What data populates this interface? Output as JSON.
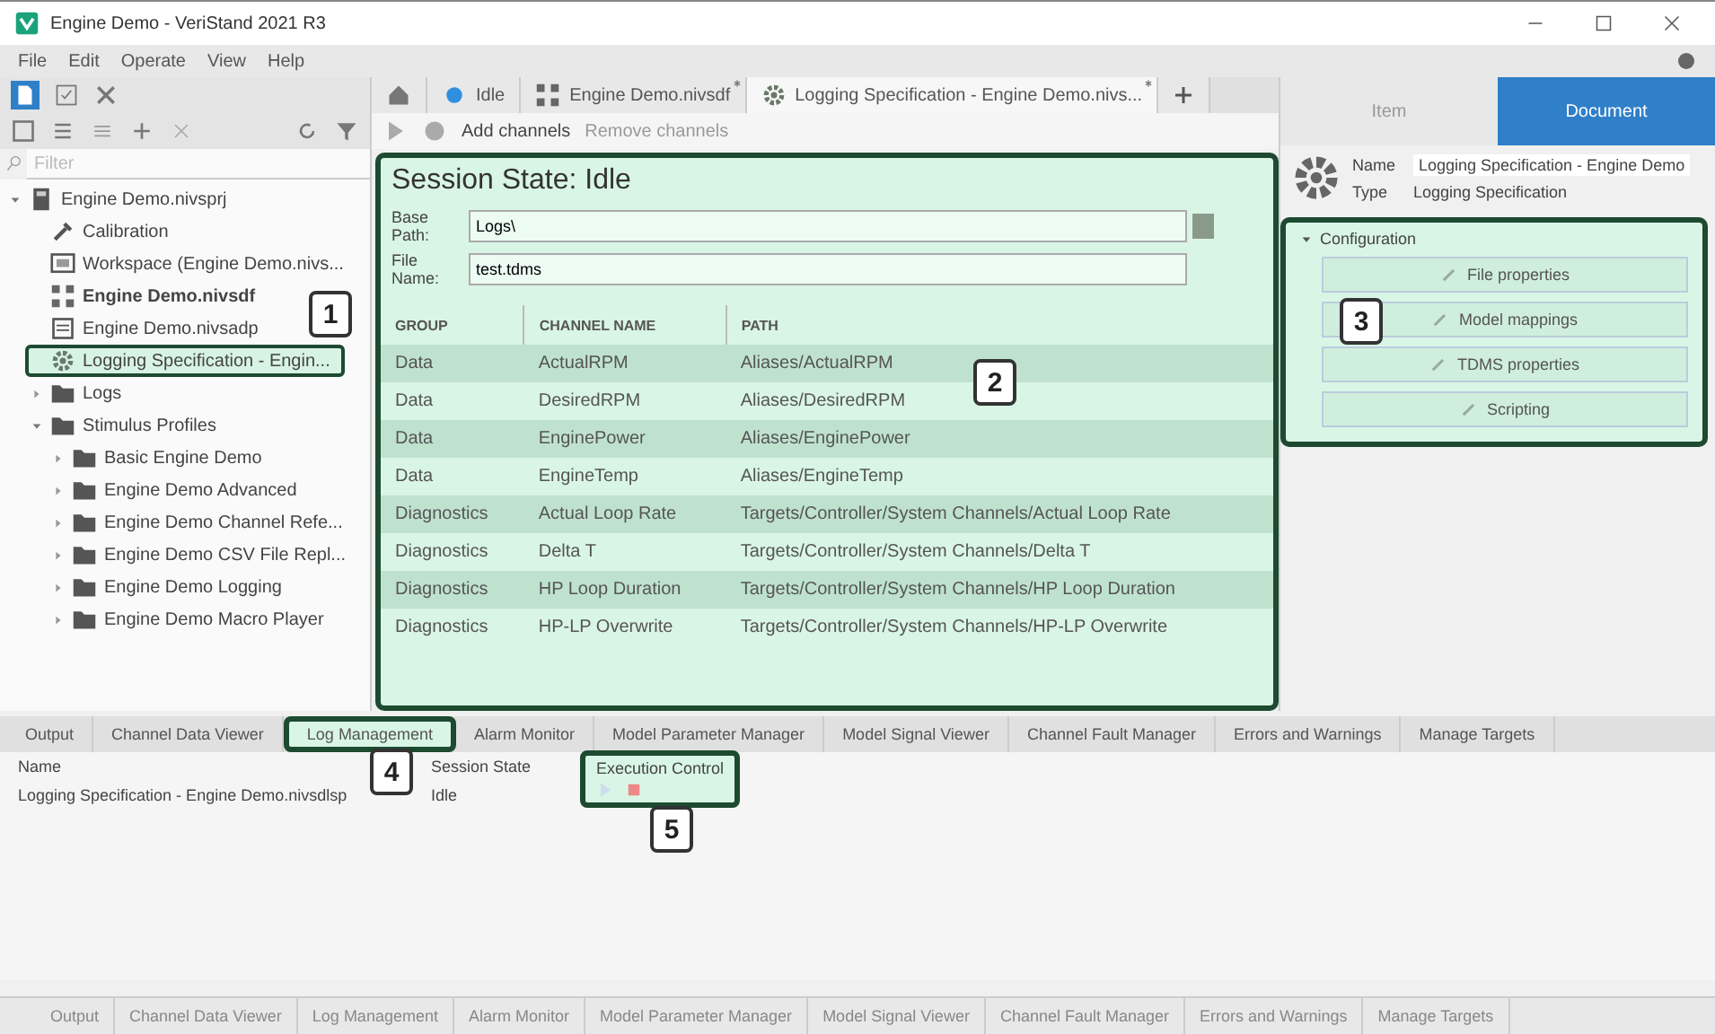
{
  "window": {
    "title": "Engine Demo - VeriStand 2021 R3"
  },
  "menu": [
    "File",
    "Edit",
    "Operate",
    "View",
    "Help"
  ],
  "left_panel": {
    "search": {
      "placeholder": "Filter"
    },
    "tree": [
      {
        "label": "Engine Demo.nivsprj",
        "kind": "project",
        "expanded": true,
        "selected": false,
        "active": false,
        "children": [
          {
            "label": "Calibration",
            "kind": "calibration",
            "selected": false,
            "active": false
          },
          {
            "label": "Workspace (Engine Demo.nivs...",
            "kind": "workspace",
            "selected": false,
            "active": false
          },
          {
            "label": "Engine Demo.nivsdf",
            "kind": "sysdef",
            "selected": false,
            "active": true
          },
          {
            "label": "Engine Demo.nivsadp",
            "kind": "file",
            "selected": false,
            "active": false
          },
          {
            "label": "Logging Specification - Engin...",
            "kind": "gear",
            "selected": true,
            "active": false
          },
          {
            "label": "Logs",
            "kind": "folder",
            "expanded": false,
            "selected": false,
            "active": false
          },
          {
            "label": "Stimulus Profiles",
            "kind": "folder",
            "expanded": true,
            "selected": false,
            "active": false,
            "children": [
              {
                "label": "Basic Engine Demo",
                "kind": "folder",
                "expanded": false,
                "selected": false,
                "active": false
              },
              {
                "label": "Engine Demo Advanced",
                "kind": "folder",
                "expanded": false,
                "selected": false,
                "active": false
              },
              {
                "label": "Engine Demo Channel Refe...",
                "kind": "folder",
                "expanded": false,
                "selected": false,
                "active": false
              },
              {
                "label": "Engine Demo CSV File Repl...",
                "kind": "folder",
                "expanded": false,
                "selected": false,
                "active": false
              },
              {
                "label": "Engine Demo Logging",
                "kind": "folder",
                "expanded": false,
                "selected": false,
                "active": false
              },
              {
                "label": "Engine Demo Macro Player",
                "kind": "folder",
                "expanded": false,
                "selected": false,
                "active": false
              }
            ]
          }
        ]
      }
    ]
  },
  "document_tabs": [
    {
      "label": "Idle",
      "kind": "status",
      "selected": false,
      "modified": false
    },
    {
      "label": "Engine Demo.nivsdf",
      "kind": "sysdef",
      "selected": false,
      "modified": true
    },
    {
      "label": "Logging Specification - Engine Demo.nivs...",
      "kind": "gear",
      "selected": true,
      "modified": true
    }
  ],
  "center_toolbar": {
    "add_channels": {
      "label": "Add channels",
      "disabled": false
    },
    "remove_channels": {
      "label": "Remove channels",
      "disabled": true
    }
  },
  "session": {
    "title": "Session State: Idle",
    "base_path": {
      "label": "Base Path:",
      "value": "Logs\\"
    },
    "file_name": {
      "label": "File Name:",
      "value": "test.tdms"
    },
    "table": {
      "columns": [
        "GROUP",
        "CHANNEL NAME",
        "PATH"
      ],
      "rows": [
        [
          "Data",
          "ActualRPM",
          "Aliases/ActualRPM"
        ],
        [
          "Data",
          "DesiredRPM",
          "Aliases/DesiredRPM"
        ],
        [
          "Data",
          "EnginePower",
          "Aliases/EnginePower"
        ],
        [
          "Data",
          "EngineTemp",
          "Aliases/EngineTemp"
        ],
        [
          "Diagnostics",
          "Actual Loop Rate",
          "Targets/Controller/System Channels/Actual Loop Rate"
        ],
        [
          "Diagnostics",
          "Delta T",
          "Targets/Controller/System Channels/Delta T"
        ],
        [
          "Diagnostics",
          "HP Loop Duration",
          "Targets/Controller/System Channels/HP Loop Duration"
        ],
        [
          "Diagnostics",
          "HP-LP Overwrite",
          "Targets/Controller/System Channels/HP-LP Overwrite"
        ]
      ]
    }
  },
  "properties": {
    "tabs": [
      {
        "label": "Item",
        "selected": false
      },
      {
        "label": "Document",
        "selected": true
      }
    ],
    "name": {
      "label": "Name",
      "value": "Logging Specification - Engine Demo"
    },
    "type": {
      "label": "Type",
      "value": "Logging Specification"
    },
    "configuration": {
      "title": "Configuration",
      "expanded": true,
      "buttons": [
        "File properties",
        "Model mappings",
        "TDMS properties",
        "Scripting"
      ]
    }
  },
  "bottom_tabs": [
    {
      "label": "Output",
      "selected": false
    },
    {
      "label": "Channel Data Viewer",
      "selected": false
    },
    {
      "label": "Log Management",
      "selected": true
    },
    {
      "label": "Alarm Monitor",
      "selected": false
    },
    {
      "label": "Model Parameter Manager",
      "selected": false
    },
    {
      "label": "Model Signal Viewer",
      "selected": false
    },
    {
      "label": "Channel Fault Manager",
      "selected": false
    },
    {
      "label": "Errors and Warnings",
      "selected": false
    },
    {
      "label": "Manage Targets",
      "selected": false
    }
  ],
  "log_management": {
    "columns": [
      "Name",
      "Session State",
      "Execution Control"
    ],
    "rows": [
      {
        "name": "Logging Specification - Engine Demo.nivsdlsp",
        "state": "Idle",
        "running": false
      }
    ]
  },
  "footer_tabs": [
    "Output",
    "Channel Data Viewer",
    "Log Management",
    "Alarm Monitor",
    "Model Parameter Manager",
    "Model Signal Viewer",
    "Channel Fault Manager",
    "Errors and Warnings",
    "Manage Targets"
  ],
  "callouts": [
    "1",
    "2",
    "3",
    "4",
    "5"
  ]
}
